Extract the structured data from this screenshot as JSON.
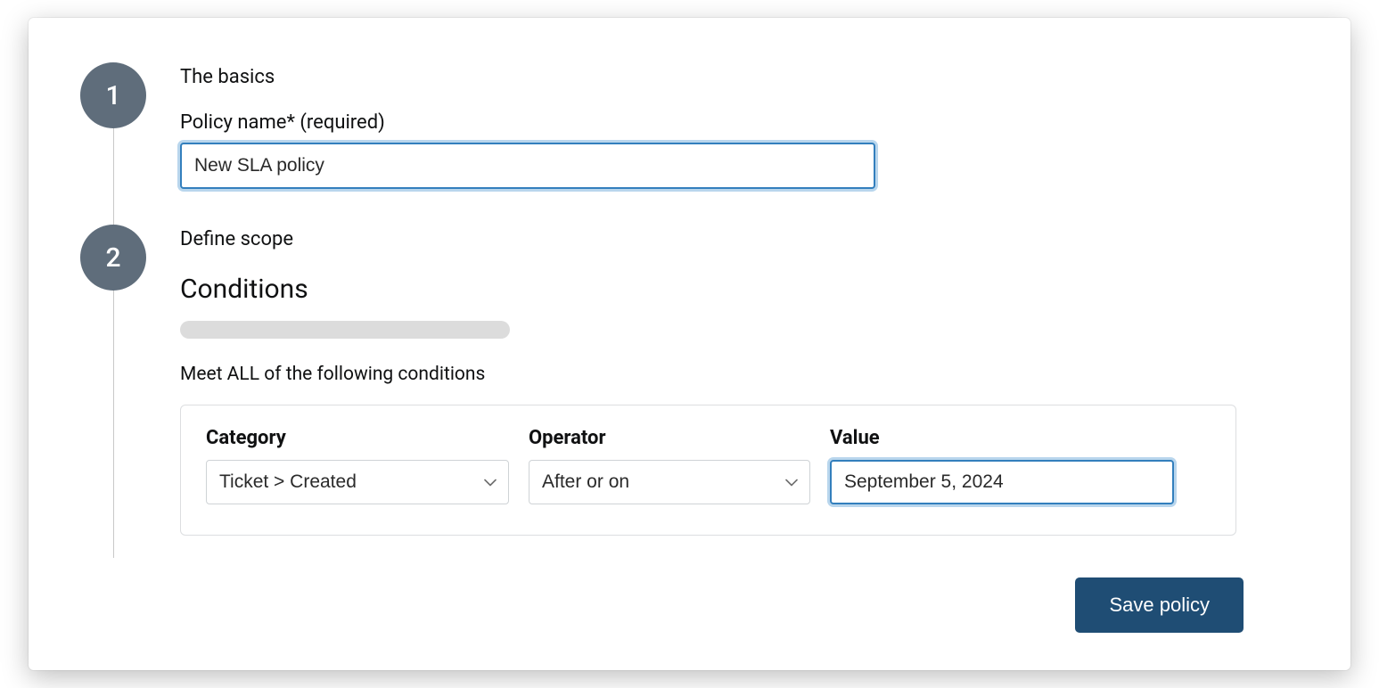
{
  "steps": {
    "basics": {
      "number": "1",
      "title": "The basics",
      "policy_name_label": "Policy name* (required)",
      "policy_name_value": "New SLA policy"
    },
    "scope": {
      "number": "2",
      "title": "Define scope",
      "conditions_heading": "Conditions",
      "conditions_intro": "Meet ALL of the following conditions",
      "columns": {
        "category_label": "Category",
        "operator_label": "Operator",
        "value_label": "Value"
      },
      "row": {
        "category": "Ticket > Created",
        "operator": "After or on",
        "value": "September 5, 2024"
      }
    }
  },
  "actions": {
    "save_label": "Save policy"
  }
}
